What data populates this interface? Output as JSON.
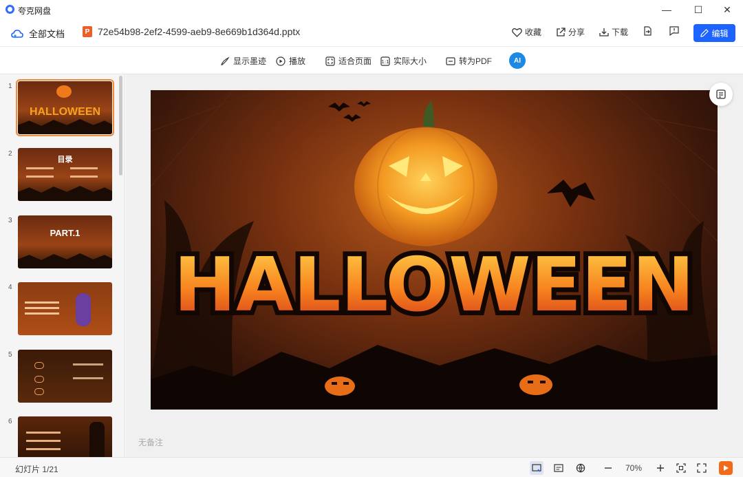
{
  "titlebar": {
    "app_name": "夸克网盘",
    "minimize": "—",
    "maximize": "☐",
    "close": "✕"
  },
  "header": {
    "all_files_label": "全部文档",
    "file_name": "72e54b98-2ef2-4599-aeb9-8e669b1d364d.pptx",
    "file_icon_letter": "P",
    "favorite_label": "收藏",
    "share_label": "分享",
    "download_label": "下载",
    "edit_label": "编辑"
  },
  "toolbar": {
    "show_ink_label": "显示墨迹",
    "play_label": "播放",
    "fit_page_label": "适合页面",
    "actual_size_label": "实际大小",
    "to_pdf_label": "转为PDF",
    "ai_label": "AI"
  },
  "thumbnails": [
    {
      "num": "1",
      "title": "HALLOWEEN"
    },
    {
      "num": "2",
      "title": "目录"
    },
    {
      "num": "3",
      "title": "PART.1"
    },
    {
      "num": "4",
      "title": ""
    },
    {
      "num": "5",
      "title": ""
    },
    {
      "num": "6",
      "title": ""
    }
  ],
  "slide": {
    "title": "HALLOWEEN"
  },
  "notes": {
    "placeholder": "无备注"
  },
  "status": {
    "slide_count": "幻灯片 1/21",
    "zoom": "70%"
  },
  "colors": {
    "accent": "#1d63ff",
    "selection": "#f28b3c",
    "ppt": "#e8612c"
  }
}
